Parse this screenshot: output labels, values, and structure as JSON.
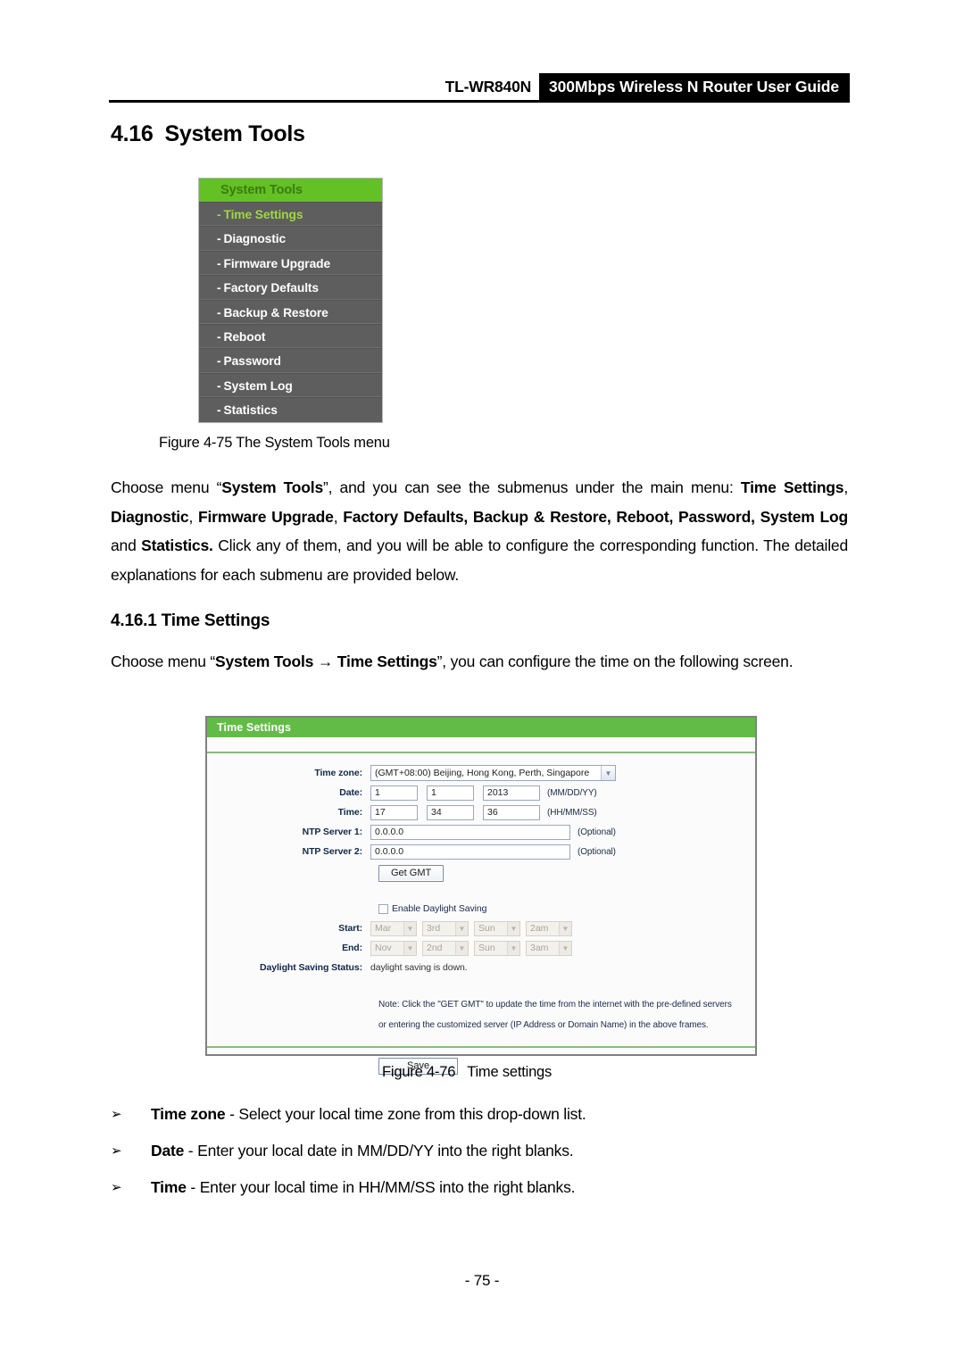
{
  "header": {
    "model": "TL-WR840N",
    "band_title": "300Mbps Wireless N Router User Guide"
  },
  "headings": {
    "h1_num": "4.16",
    "h1_text": "System Tools",
    "h2_num": "4.16.1",
    "h2_text": "Time Settings"
  },
  "system_tools_menu": {
    "title": "System Tools",
    "items": [
      {
        "dash": "-",
        "label": "Time Settings",
        "active": true
      },
      {
        "dash": "-",
        "label": "Diagnostic",
        "active": false
      },
      {
        "dash": "-",
        "label": "Firmware Upgrade",
        "active": false
      },
      {
        "dash": "-",
        "label": "Factory Defaults",
        "active": false
      },
      {
        "dash": "-",
        "label": "Backup & Restore",
        "active": false
      },
      {
        "dash": "-",
        "label": "Reboot",
        "active": false
      },
      {
        "dash": "-",
        "label": "Password",
        "active": false
      },
      {
        "dash": "-",
        "label": "System Log",
        "active": false
      },
      {
        "dash": "-",
        "label": "Statistics",
        "active": false
      }
    ],
    "colors": {
      "header_bg": "#63c025",
      "header_text": "#3c7a12",
      "item_bg": "#5e5e5e",
      "item_text": "#ffffff",
      "active_text": "#9fd83f"
    }
  },
  "captions": {
    "fig75": "Figure 4-75 The System Tools menu",
    "fig76_label": "Figure 4-76",
    "fig76_text": "Time settings"
  },
  "paragraphs": {
    "p1_part1": "Choose menu “",
    "p1_b1": "System Tools",
    "p1_part2": "”, and you can see the submenus under the main menu: ",
    "p1_b2": "Time Settings",
    "p1_part3": ", ",
    "p1_b3": "Diagnostic",
    "p1_part4": ", ",
    "p1_b4": "Firmware Upgrade",
    "p1_part5": ", ",
    "p1_b5": "Factory Defaults, Backup & Restore, Reboot, Password, System Log",
    "p1_part6": " and ",
    "p1_b6": "Statistics.",
    "p1_part7": " Click any of them, and you will be able to configure the corresponding function. The detailed explanations for each submenu are provided below.",
    "p2_part1": "Choose menu “",
    "p2_b1": "System Tools",
    "p2_arrow": "→",
    "p2_b2": "Time Settings",
    "p2_part2": "”, you can configure the time on the following screen."
  },
  "time_settings_panel": {
    "title": "Time Settings",
    "colors": {
      "title_bg": "#62bb46",
      "divider": "#8cba7e",
      "border": "#808080"
    },
    "fields": {
      "timezone_label": "Time zone:",
      "timezone_value": "(GMT+08:00) Beijing, Hong Kong, Perth, Singapore",
      "date_label": "Date:",
      "date_month": "1",
      "date_day": "1",
      "date_year": "2013",
      "date_hint": "(MM/DD/YY)",
      "time_label": "Time:",
      "time_hour": "17",
      "time_minute": "34",
      "time_second": "36",
      "time_hint": "(HH/MM/SS)",
      "ntp1_label": "NTP Server 1:",
      "ntp1_value": "0.0.0.0",
      "ntp1_hint": "(Optional)",
      "ntp2_label": "NTP Server 2:",
      "ntp2_value": "0.0.0.0",
      "ntp2_hint": "(Optional)",
      "get_gmt_button": "Get GMT"
    },
    "daylight": {
      "enable_label": "Enable Daylight Saving",
      "enabled": false,
      "start_label": "Start:",
      "start_month": "Mar",
      "start_week": "3rd",
      "start_day": "Sun",
      "start_hour": "2am",
      "end_label": "End:",
      "end_month": "Nov",
      "end_week": "2nd",
      "end_day": "Sun",
      "end_hour": "3am",
      "status_label": "Daylight Saving Status:",
      "status_value": "daylight saving is down."
    },
    "note_line1": "Note: Click the \"GET GMT\" to update the time from the internet with the pre-defined servers",
    "note_line2": "or entering the customized server (IP Address or Domain Name) in the above frames.",
    "save_button": "Save"
  },
  "bullets": [
    {
      "marker": "➢",
      "term": "Time zone",
      "sep": " - ",
      "desc": "Select your local time zone from this drop-down list."
    },
    {
      "marker": "➢",
      "term": "Date",
      "sep": " - ",
      "desc": "Enter your local date in MM/DD/YY into the right blanks."
    },
    {
      "marker": "➢",
      "term": "Time",
      "sep": " - ",
      "desc": "Enter your local time in HH/MM/SS into the right blanks."
    }
  ],
  "footer": {
    "page_number": "- 75 -"
  }
}
